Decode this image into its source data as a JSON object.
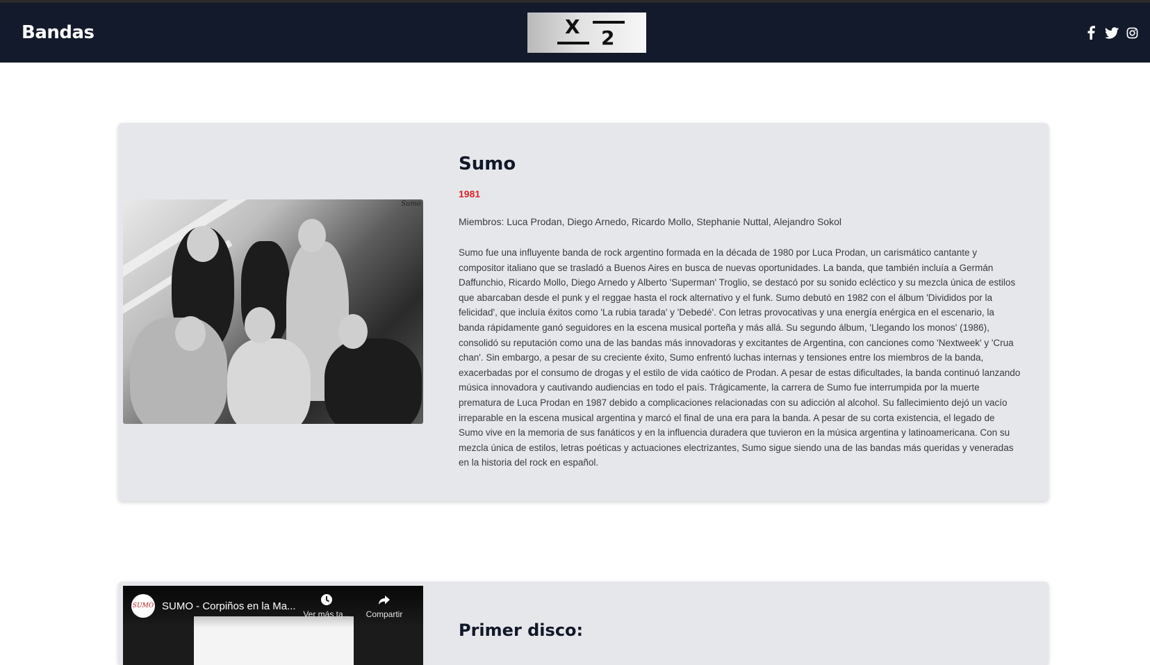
{
  "header": {
    "brand": "Bandas",
    "logo": {
      "top": "X",
      "bottom": "2"
    },
    "social": [
      "facebook-icon",
      "twitter-icon",
      "instagram-icon"
    ]
  },
  "band": {
    "name": "Sumo",
    "year": "1981",
    "photo_caption": "Sumo",
    "members": "Miembros: Luca Prodan, Diego Arnedo, Ricardo Mollo, Stephanie Nuttal, Alejandro Sokol",
    "description": "Sumo fue una influyente banda de rock argentino formada en la década de 1980 por Luca Prodan, un carismático cantante y compositor italiano que se trasladó a Buenos Aires en busca de nuevas oportunidades. La banda, que también incluía a Germán Daffunchio, Ricardo Mollo, Diego Arnedo y Alberto 'Superman' Troglio, se destacó por su sonido ecléctico y su mezcla única de estilos que abarcaban desde el punk y el reggae hasta el rock alternativo y el funk. Sumo debutó en 1982 con el álbum 'Divididos por la felicidad', que incluía éxitos como 'La rubia tarada' y 'Debedé'. Con letras provocativas y una energía enérgica en el escenario, la banda rápidamente ganó seguidores en la escena musical porteña y más allá. Su segundo álbum, 'Llegando los monos' (1986), consolidó su reputación como una de las bandas más innovadoras y excitantes de Argentina, con canciones como 'Nextweek' y 'Crua chan'. Sin embargo, a pesar de su creciente éxito, Sumo enfrentó luchas internas y tensiones entre los miembros de la banda, exacerbadas por el consumo de drogas y el estilo de vida caótico de Prodan. A pesar de estas dificultades, la banda continuó lanzando música innovadora y cautivando audiencias en todo el país. Trágicamente, la carrera de Sumo fue interrumpida por la muerte prematura de Luca Prodan en 1987 debido a complicaciones relacionadas con su adicción al alcohol. Su fallecimiento dejó un vacío irreparable en la escena musical argentina y marcó el final de una era para la banda. A pesar de su corta existencia, el legado de Sumo vive en la memoria de sus fanáticos y en la influencia duradera que tuvieron en la música argentina y latinoamericana. Con su mezcla única de estilos, letras poéticas y actuaciones electrizantes, Sumo sigue siendo una de las bandas más queridas y veneradas en la historia del rock en español."
  },
  "first_album": {
    "heading": "Primer disco:",
    "video": {
      "channel_logo": "SUMO",
      "title": "SUMO - Corpiños en la Ma...",
      "watch_later": "Ver más ta...",
      "share": "Compartir"
    }
  }
}
